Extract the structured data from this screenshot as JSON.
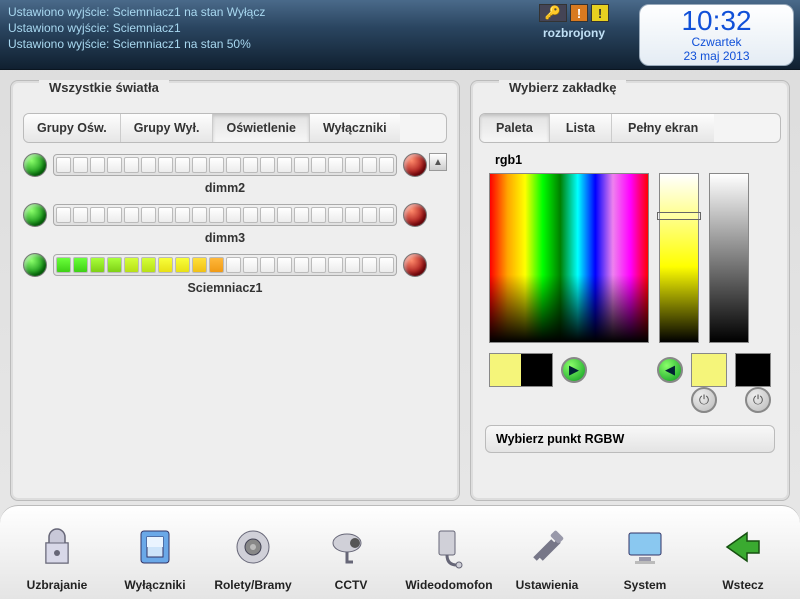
{
  "status_log": [
    "Ustawiono wyjście: Sciemniacz1 na stan Wyłącz",
    "Ustawiono wyjście: Sciemniacz1",
    "Ustawiono wyjście: Sciemniacz1 na stan 50%"
  ],
  "arm_status": "rozbrojony",
  "clock": {
    "time": "10:32",
    "day": "Czwartek",
    "date": "23 maj 2013"
  },
  "left_panel": {
    "title": "Wszystkie światła",
    "tabs": [
      "Grupy Ośw.",
      "Grupy Wył.",
      "Oświetlenie",
      "Wyłączniki"
    ],
    "active_tab": 2,
    "dimmers": [
      {
        "name": "dimm2",
        "level": 0,
        "segments": 20
      },
      {
        "name": "dimm3",
        "level": 0,
        "segments": 20
      },
      {
        "name": "Sciemniacz1",
        "level": 10,
        "segments": 20
      }
    ]
  },
  "right_panel": {
    "title": "Wybierz zakładkę",
    "tabs": [
      "Paleta",
      "Lista",
      "Pełny ekran"
    ],
    "active_tab": 0,
    "rgb_label": "rgb1",
    "footer": "Wybierz punkt RGBW"
  },
  "toolbar": [
    {
      "id": "uzbrajanie",
      "label": "Uzbrajanie"
    },
    {
      "id": "wylaczniki",
      "label": "Wyłączniki"
    },
    {
      "id": "rolety",
      "label": "Rolety/Bramy"
    },
    {
      "id": "cctv",
      "label": "CCTV"
    },
    {
      "id": "wideodomofon",
      "label": "Wideodomofon"
    },
    {
      "id": "ustawienia",
      "label": "Ustawienia"
    },
    {
      "id": "system",
      "label": "System"
    },
    {
      "id": "wstecz",
      "label": "Wstecz"
    }
  ]
}
